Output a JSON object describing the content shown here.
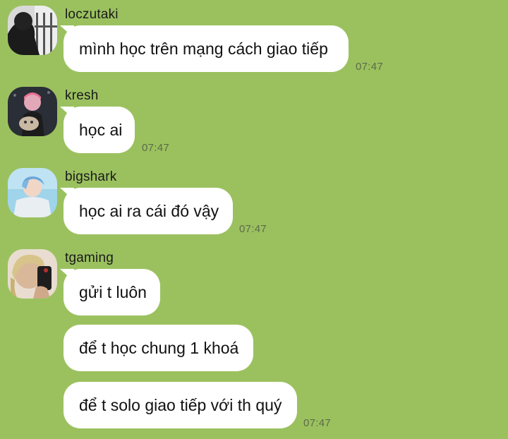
{
  "messages": [
    {
      "sender": "loczutaki",
      "avatar_icon": "user-avatar-dark-photo",
      "texts": [
        "mình học trên mạng cách giao tiếp"
      ],
      "time": "07:47"
    },
    {
      "sender": "kresh",
      "avatar_icon": "user-avatar-pink-hair-photo",
      "texts": [
        "học ai"
      ],
      "time": "07:47"
    },
    {
      "sender": "bigshark",
      "avatar_icon": "user-avatar-blue-hair-photo",
      "texts": [
        "học ai ra cái đó vậy"
      ],
      "time": "07:47"
    },
    {
      "sender": "tgaming",
      "avatar_icon": "user-avatar-blond-selfie-photo",
      "texts": [
        "gửi t luôn",
        "để t học chung 1 khoá",
        "để t solo giao tiếp với th quý"
      ],
      "time": "07:47"
    }
  ],
  "colors": {
    "background": "#9bc15f",
    "bubble": "#ffffff",
    "timestamp": "#5c6b48"
  }
}
